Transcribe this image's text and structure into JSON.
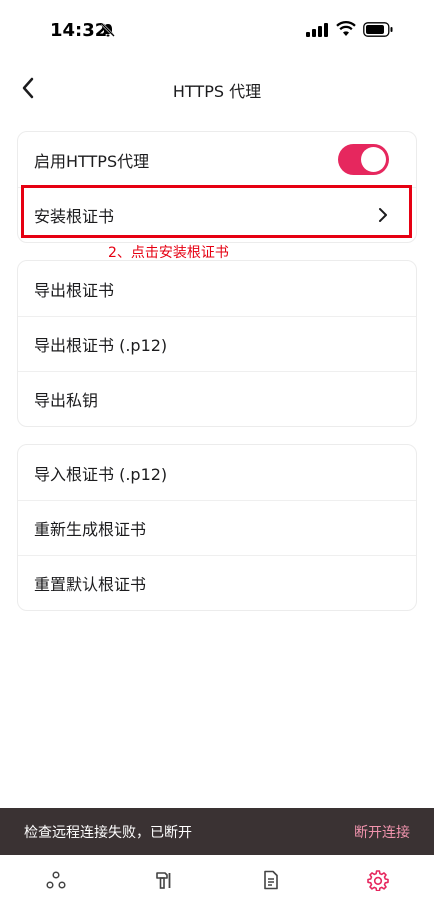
{
  "status_bar": {
    "time": "14:32",
    "icons": [
      "bell-slash-icon",
      "signal-icon",
      "wifi-icon",
      "battery-icon"
    ]
  },
  "nav": {
    "title": "HTTPS 代理",
    "back_icon": "chevron-left-icon"
  },
  "group1": {
    "enable_label": "启用HTTPS代理",
    "enable_on": true,
    "install_label": "安装根证书"
  },
  "annotation": {
    "text": "2、点击安装根证书",
    "color": "#e60012"
  },
  "group2": {
    "items": [
      {
        "label": "导出根证书"
      },
      {
        "label": "导出根证书 (.p12)"
      },
      {
        "label": "导出私钥"
      }
    ]
  },
  "group3": {
    "items": [
      {
        "label": "导入根证书 (.p12)"
      },
      {
        "label": "重新生成根证书"
      },
      {
        "label": "重置默认根证书"
      }
    ]
  },
  "toast": {
    "message": "检查远程连接失败，已断开",
    "action": "断开连接"
  },
  "tab_bar": {
    "tabs": [
      {
        "icon": "nodes-icon",
        "active": false
      },
      {
        "icon": "tools-icon",
        "active": false
      },
      {
        "icon": "document-icon",
        "active": false
      },
      {
        "icon": "settings-gear-icon",
        "active": true
      }
    ]
  },
  "colors": {
    "accent": "#e6275e",
    "toast_bg": "#3a3233",
    "toast_action": "#f093ad"
  }
}
